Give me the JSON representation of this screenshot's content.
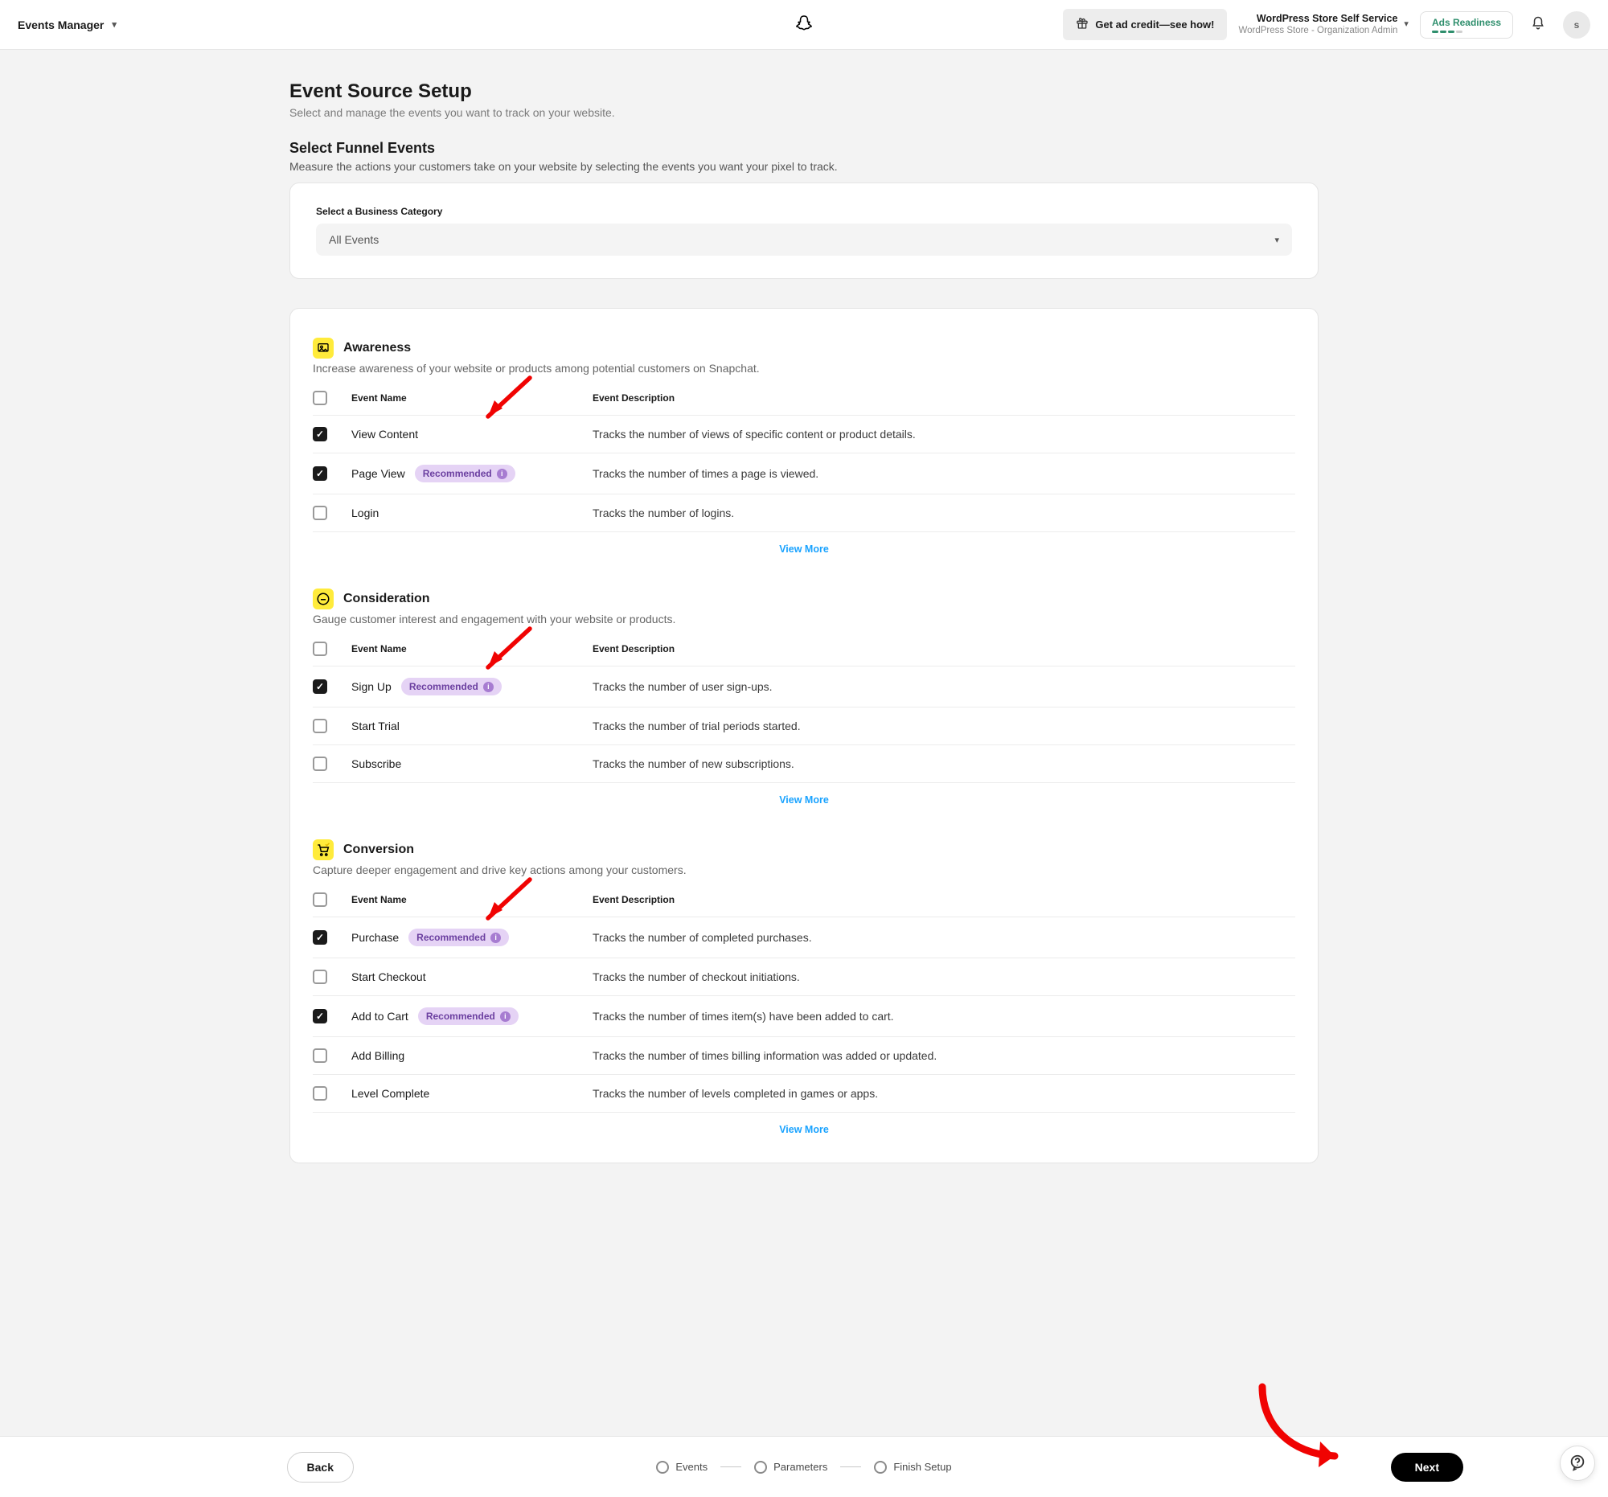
{
  "topbar": {
    "nav_title": "Events Manager",
    "ad_credit": "Get ad credit—see how!",
    "org_title": "WordPress Store Self Service",
    "org_sub": "WordPress Store - Organization Admin",
    "ads_readiness": "Ads Readiness",
    "avatar_initial": "s"
  },
  "page": {
    "title": "Event Source Setup",
    "subtitle": "Select and manage the events you want to track on your website.",
    "section_title": "Select Funnel Events",
    "section_sub": "Measure the actions your customers take on your website by selecting the events you want your pixel to track.",
    "category_label": "Select a Business Category",
    "category_value": "All Events"
  },
  "badge_label": "Recommended",
  "thead": {
    "name": "Event Name",
    "desc": "Event Description"
  },
  "view_more": "View More",
  "sections": {
    "awareness": {
      "title": "Awareness",
      "desc": "Increase awareness of your website or products among potential customers on Snapchat.",
      "events": [
        {
          "name": "View Content",
          "desc": "Tracks the number of views of specific content or product details.",
          "checked": true,
          "recommended": false
        },
        {
          "name": "Page View",
          "desc": "Tracks the number of times a page is viewed.",
          "checked": true,
          "recommended": true
        },
        {
          "name": "Login",
          "desc": "Tracks the number of logins.",
          "checked": false,
          "recommended": false
        }
      ]
    },
    "consideration": {
      "title": "Consideration",
      "desc": "Gauge customer interest and engagement with your website or products.",
      "events": [
        {
          "name": "Sign Up",
          "desc": "Tracks the number of user sign-ups.",
          "checked": true,
          "recommended": true
        },
        {
          "name": "Start Trial",
          "desc": "Tracks the number of trial periods started.",
          "checked": false,
          "recommended": false
        },
        {
          "name": "Subscribe",
          "desc": "Tracks the number of new subscriptions.",
          "checked": false,
          "recommended": false
        }
      ]
    },
    "conversion": {
      "title": "Conversion",
      "desc": "Capture deeper engagement and drive key actions among your customers.",
      "events": [
        {
          "name": "Purchase",
          "desc": "Tracks the number of completed purchases.",
          "checked": true,
          "recommended": true
        },
        {
          "name": "Start Checkout",
          "desc": "Tracks the number of checkout initiations.",
          "checked": false,
          "recommended": false
        },
        {
          "name": "Add to Cart",
          "desc": "Tracks the number of times item(s) have been added to cart.",
          "checked": true,
          "recommended": true
        },
        {
          "name": "Add Billing",
          "desc": "Tracks the number of times billing information was added or updated.",
          "checked": false,
          "recommended": false
        },
        {
          "name": "Level Complete",
          "desc": "Tracks the number of levels completed in games or apps.",
          "checked": false,
          "recommended": false
        }
      ]
    }
  },
  "footer": {
    "back": "Back",
    "next": "Next",
    "steps": [
      "Events",
      "Parameters",
      "Finish Setup"
    ]
  }
}
